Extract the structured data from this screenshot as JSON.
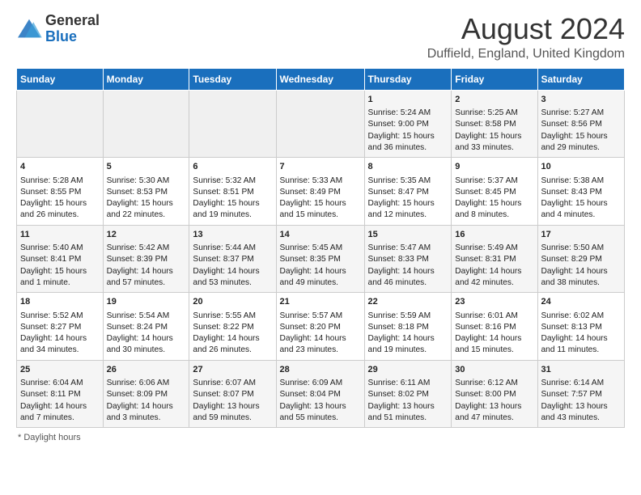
{
  "logo": {
    "general": "General",
    "blue": "Blue"
  },
  "header": {
    "title": "August 2024",
    "subtitle": "Duffield, England, United Kingdom"
  },
  "weekdays": [
    "Sunday",
    "Monday",
    "Tuesday",
    "Wednesday",
    "Thursday",
    "Friday",
    "Saturday"
  ],
  "footer": {
    "daylight_label": "Daylight hours"
  },
  "weeks": [
    [
      {
        "day": "",
        "content": ""
      },
      {
        "day": "",
        "content": ""
      },
      {
        "day": "",
        "content": ""
      },
      {
        "day": "",
        "content": ""
      },
      {
        "day": "1",
        "content": "Sunrise: 5:24 AM\nSunset: 9:00 PM\nDaylight: 15 hours and 36 minutes."
      },
      {
        "day": "2",
        "content": "Sunrise: 5:25 AM\nSunset: 8:58 PM\nDaylight: 15 hours and 33 minutes."
      },
      {
        "day": "3",
        "content": "Sunrise: 5:27 AM\nSunset: 8:56 PM\nDaylight: 15 hours and 29 minutes."
      }
    ],
    [
      {
        "day": "4",
        "content": "Sunrise: 5:28 AM\nSunset: 8:55 PM\nDaylight: 15 hours and 26 minutes."
      },
      {
        "day": "5",
        "content": "Sunrise: 5:30 AM\nSunset: 8:53 PM\nDaylight: 15 hours and 22 minutes."
      },
      {
        "day": "6",
        "content": "Sunrise: 5:32 AM\nSunset: 8:51 PM\nDaylight: 15 hours and 19 minutes."
      },
      {
        "day": "7",
        "content": "Sunrise: 5:33 AM\nSunset: 8:49 PM\nDaylight: 15 hours and 15 minutes."
      },
      {
        "day": "8",
        "content": "Sunrise: 5:35 AM\nSunset: 8:47 PM\nDaylight: 15 hours and 12 minutes."
      },
      {
        "day": "9",
        "content": "Sunrise: 5:37 AM\nSunset: 8:45 PM\nDaylight: 15 hours and 8 minutes."
      },
      {
        "day": "10",
        "content": "Sunrise: 5:38 AM\nSunset: 8:43 PM\nDaylight: 15 hours and 4 minutes."
      }
    ],
    [
      {
        "day": "11",
        "content": "Sunrise: 5:40 AM\nSunset: 8:41 PM\nDaylight: 15 hours and 1 minute."
      },
      {
        "day": "12",
        "content": "Sunrise: 5:42 AM\nSunset: 8:39 PM\nDaylight: 14 hours and 57 minutes."
      },
      {
        "day": "13",
        "content": "Sunrise: 5:44 AM\nSunset: 8:37 PM\nDaylight: 14 hours and 53 minutes."
      },
      {
        "day": "14",
        "content": "Sunrise: 5:45 AM\nSunset: 8:35 PM\nDaylight: 14 hours and 49 minutes."
      },
      {
        "day": "15",
        "content": "Sunrise: 5:47 AM\nSunset: 8:33 PM\nDaylight: 14 hours and 46 minutes."
      },
      {
        "day": "16",
        "content": "Sunrise: 5:49 AM\nSunset: 8:31 PM\nDaylight: 14 hours and 42 minutes."
      },
      {
        "day": "17",
        "content": "Sunrise: 5:50 AM\nSunset: 8:29 PM\nDaylight: 14 hours and 38 minutes."
      }
    ],
    [
      {
        "day": "18",
        "content": "Sunrise: 5:52 AM\nSunset: 8:27 PM\nDaylight: 14 hours and 34 minutes."
      },
      {
        "day": "19",
        "content": "Sunrise: 5:54 AM\nSunset: 8:24 PM\nDaylight: 14 hours and 30 minutes."
      },
      {
        "day": "20",
        "content": "Sunrise: 5:55 AM\nSunset: 8:22 PM\nDaylight: 14 hours and 26 minutes."
      },
      {
        "day": "21",
        "content": "Sunrise: 5:57 AM\nSunset: 8:20 PM\nDaylight: 14 hours and 23 minutes."
      },
      {
        "day": "22",
        "content": "Sunrise: 5:59 AM\nSunset: 8:18 PM\nDaylight: 14 hours and 19 minutes."
      },
      {
        "day": "23",
        "content": "Sunrise: 6:01 AM\nSunset: 8:16 PM\nDaylight: 14 hours and 15 minutes."
      },
      {
        "day": "24",
        "content": "Sunrise: 6:02 AM\nSunset: 8:13 PM\nDaylight: 14 hours and 11 minutes."
      }
    ],
    [
      {
        "day": "25",
        "content": "Sunrise: 6:04 AM\nSunset: 8:11 PM\nDaylight: 14 hours and 7 minutes."
      },
      {
        "day": "26",
        "content": "Sunrise: 6:06 AM\nSunset: 8:09 PM\nDaylight: 14 hours and 3 minutes."
      },
      {
        "day": "27",
        "content": "Sunrise: 6:07 AM\nSunset: 8:07 PM\nDaylight: 13 hours and 59 minutes."
      },
      {
        "day": "28",
        "content": "Sunrise: 6:09 AM\nSunset: 8:04 PM\nDaylight: 13 hours and 55 minutes."
      },
      {
        "day": "29",
        "content": "Sunrise: 6:11 AM\nSunset: 8:02 PM\nDaylight: 13 hours and 51 minutes."
      },
      {
        "day": "30",
        "content": "Sunrise: 6:12 AM\nSunset: 8:00 PM\nDaylight: 13 hours and 47 minutes."
      },
      {
        "day": "31",
        "content": "Sunrise: 6:14 AM\nSunset: 7:57 PM\nDaylight: 13 hours and 43 minutes."
      }
    ]
  ]
}
